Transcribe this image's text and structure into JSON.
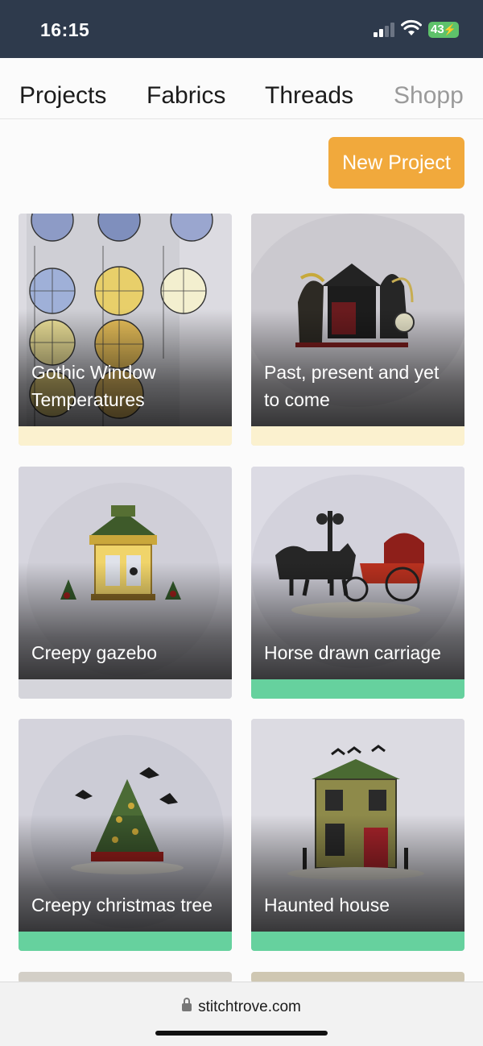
{
  "status_bar": {
    "time": "16:15",
    "battery": "43"
  },
  "tabs": [
    {
      "label": "Projects",
      "active": true
    },
    {
      "label": "Fabrics",
      "active": false
    },
    {
      "label": "Threads",
      "active": false
    },
    {
      "label": "Shopp",
      "active": false
    }
  ],
  "actions": {
    "new_project": "New Project"
  },
  "projects": [
    {
      "title": "Gothic Window Temperatures",
      "status_color": "#fbf1cf"
    },
    {
      "title": "Past, present and yet to come",
      "status_color": "#fbf1cf"
    },
    {
      "title": "Creepy gazebo",
      "status_color": "#d5d5db"
    },
    {
      "title": "Horse drawn carriage",
      "status_color": "#66d19e"
    },
    {
      "title": "Creepy christmas tree",
      "status_color": "#66d19e"
    },
    {
      "title": "Haunted house",
      "status_color": "#66d19e"
    }
  ],
  "browser": {
    "url": "stitchtrove.com"
  }
}
